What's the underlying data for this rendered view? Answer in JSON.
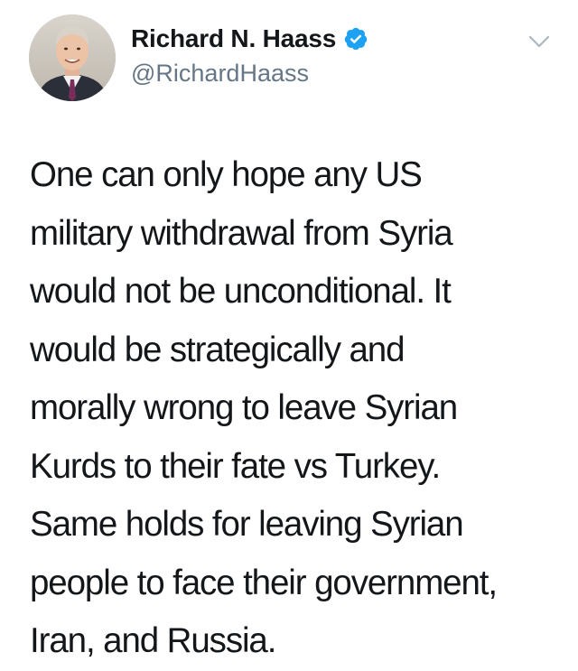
{
  "tweet": {
    "author": {
      "display_name": "Richard N. Haass",
      "handle": "@RichardHaass",
      "verified": true,
      "verified_icon": "verified-badge-icon",
      "avatar_icon": "profile-photo"
    },
    "menu_icon": "chevron-down-icon",
    "text_lines": [
      "One can only hope any US",
      "military withdrawal from Syria",
      "would not be unconditional. It",
      "would be strategically and",
      "morally wrong to leave Syrian",
      "Kurds to their fate vs Turkey.",
      "Same holds for leaving Syrian",
      "people to face their government,",
      "Iran, and Russia."
    ]
  },
  "colors": {
    "text": "#14171a",
    "secondary_text": "#657786",
    "verified_blue": "#1da1f2",
    "chevron_gray": "#aab8c2",
    "background": "#ffffff"
  }
}
